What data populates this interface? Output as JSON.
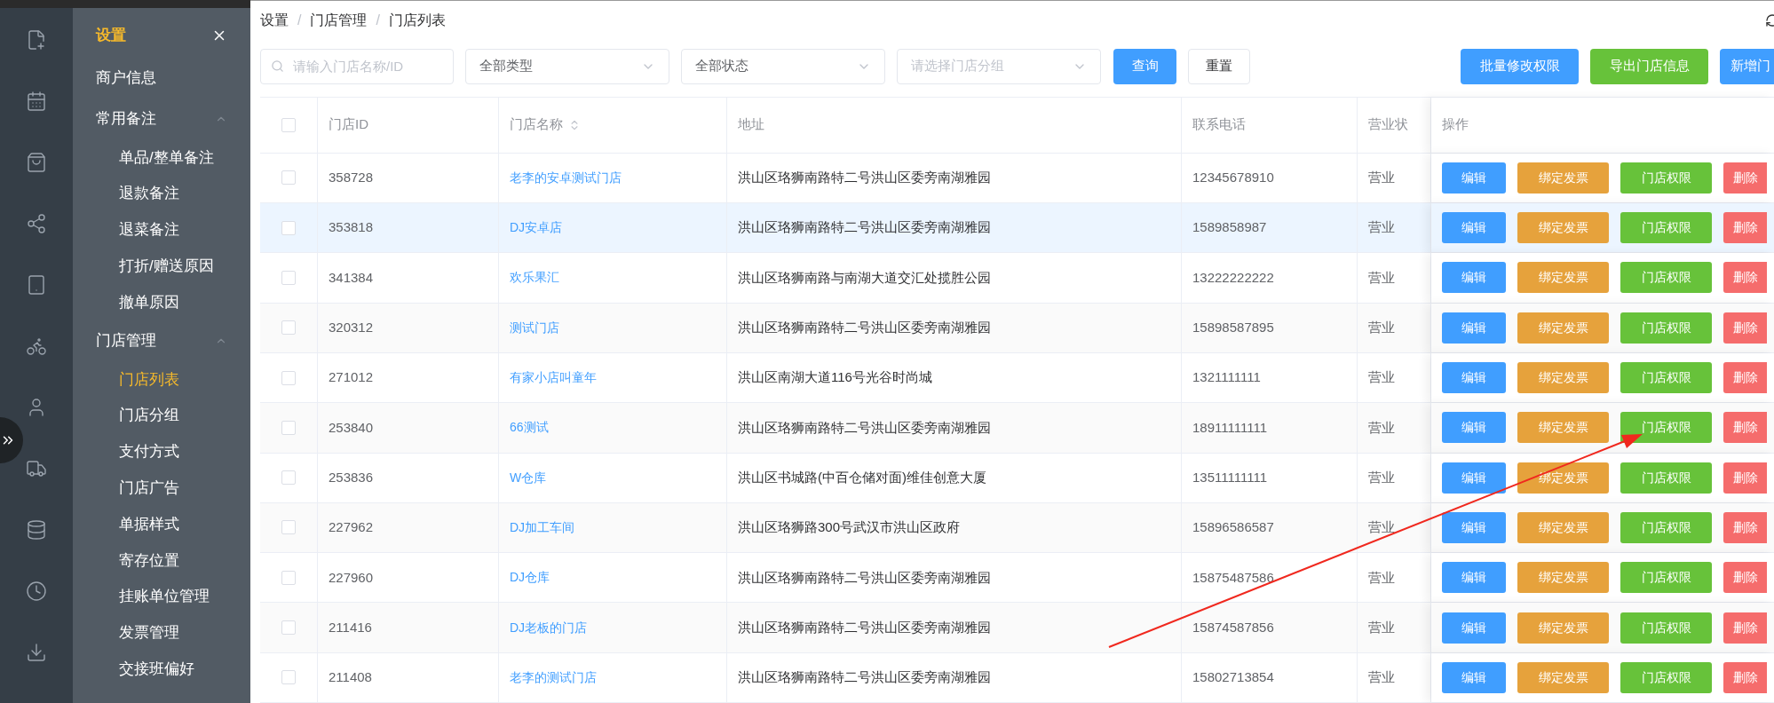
{
  "submenu": {
    "title": "设置",
    "items": [
      {
        "label": "商户信息",
        "selected": false
      },
      {
        "label": "常用备注",
        "expanded": true,
        "children": [
          {
            "label": "单品/整单备注",
            "selected": false
          },
          {
            "label": "退款备注",
            "selected": false
          },
          {
            "label": "退菜备注",
            "selected": false
          },
          {
            "label": "打折/赠送原因",
            "selected": false
          },
          {
            "label": "撤单原因",
            "selected": false
          }
        ]
      },
      {
        "label": "门店管理",
        "expanded": true,
        "children": [
          {
            "label": "门店列表",
            "selected": true
          },
          {
            "label": "门店分组",
            "selected": false
          },
          {
            "label": "支付方式",
            "selected": false
          },
          {
            "label": "门店广告",
            "selected": false
          },
          {
            "label": "单据样式",
            "selected": false
          },
          {
            "label": "寄存位置",
            "selected": false
          },
          {
            "label": "挂账单位管理",
            "selected": false
          },
          {
            "label": "发票管理",
            "selected": false
          },
          {
            "label": "交接班偏好",
            "selected": false
          }
        ]
      }
    ]
  },
  "breadcrumb": {
    "separator": "/",
    "items": [
      "设置",
      "门店管理",
      "门店列表"
    ]
  },
  "filters": {
    "search": {
      "placeholder": "请输入门店名称/ID"
    },
    "selects": [
      {
        "value": "全部类型"
      },
      {
        "value": "全部状态"
      },
      {
        "placeholder": "请选择门店分组"
      }
    ],
    "query_button": "查询",
    "reset_button": "重置"
  },
  "toolbar_buttons": [
    {
      "label": "批量修改权限",
      "kind": "primary"
    },
    {
      "label": "导出门店信息",
      "kind": "success"
    },
    {
      "label": "新增门",
      "kind": "primary"
    }
  ],
  "table": {
    "header_checked": false,
    "columns": [
      "门店ID",
      "门店名称",
      "地址",
      "联系电话",
      "营业状",
      "操作"
    ],
    "rows": [
      {
        "checked": false,
        "hovered": false,
        "id": "358728",
        "name": "老李的安卓测试门店",
        "address": "洪山区珞狮南路特二号洪山区委旁南湖雅园",
        "phone": "12345678910",
        "status": "营业",
        "actions": [
          {
            "label": "编辑",
            "kind": "edit"
          },
          {
            "label": "绑定发票",
            "kind": "invoice"
          },
          {
            "label": "门店权限",
            "kind": "permission"
          },
          {
            "label": "删除",
            "kind": "delete"
          }
        ]
      },
      {
        "checked": false,
        "hovered": true,
        "id": "353818",
        "name": "DJ安卓店",
        "address": "洪山区珞狮南路特二号洪山区委旁南湖雅园",
        "phone": "1589858987",
        "status": "营业",
        "actions": [
          {
            "label": "编辑",
            "kind": "edit"
          },
          {
            "label": "绑定发票",
            "kind": "invoice"
          },
          {
            "label": "门店权限",
            "kind": "permission"
          },
          {
            "label": "删除",
            "kind": "delete"
          }
        ]
      },
      {
        "checked": false,
        "hovered": false,
        "id": "341384",
        "name": "欢乐果汇",
        "address": "洪山区珞狮南路与南湖大道交汇处揽胜公园",
        "phone": "13222222222",
        "status": "营业",
        "actions": [
          {
            "label": "编辑",
            "kind": "edit"
          },
          {
            "label": "绑定发票",
            "kind": "invoice"
          },
          {
            "label": "门店权限",
            "kind": "permission"
          },
          {
            "label": "删除",
            "kind": "delete"
          }
        ]
      },
      {
        "checked": false,
        "hovered": false,
        "id": "320312",
        "name": "测试门店",
        "address": "洪山区珞狮南路特二号洪山区委旁南湖雅园",
        "phone": "15898587895",
        "status": "营业",
        "actions": [
          {
            "label": "编辑",
            "kind": "edit"
          },
          {
            "label": "绑定发票",
            "kind": "invoice"
          },
          {
            "label": "门店权限",
            "kind": "permission"
          },
          {
            "label": "删除",
            "kind": "delete"
          }
        ]
      },
      {
        "checked": false,
        "hovered": false,
        "id": "271012",
        "name": "有家小店叫童年",
        "address": "洪山区南湖大道116号光谷时尚城",
        "phone": "1321111111",
        "status": "营业",
        "actions": [
          {
            "label": "编辑",
            "kind": "edit"
          },
          {
            "label": "绑定发票",
            "kind": "invoice"
          },
          {
            "label": "门店权限",
            "kind": "permission"
          },
          {
            "label": "删除",
            "kind": "delete"
          }
        ]
      },
      {
        "checked": false,
        "hovered": false,
        "id": "253840",
        "name": "66测试",
        "address": "洪山区珞狮南路特二号洪山区委旁南湖雅园",
        "phone": "18911111111",
        "status": "营业",
        "actions": [
          {
            "label": "编辑",
            "kind": "edit"
          },
          {
            "label": "绑定发票",
            "kind": "invoice"
          },
          {
            "label": "门店权限",
            "kind": "permission"
          },
          {
            "label": "删除",
            "kind": "delete"
          }
        ]
      },
      {
        "checked": false,
        "hovered": false,
        "id": "253836",
        "name": "W仓库",
        "address": "洪山区书城路(中百仓储对面)维佳创意大厦",
        "phone": "13511111111",
        "status": "营业",
        "actions": [
          {
            "label": "编辑",
            "kind": "edit"
          },
          {
            "label": "绑定发票",
            "kind": "invoice"
          },
          {
            "label": "门店权限",
            "kind": "permission"
          },
          {
            "label": "删除",
            "kind": "delete"
          }
        ]
      },
      {
        "checked": false,
        "hovered": false,
        "id": "227962",
        "name": "DJ加工车间",
        "address": "洪山区珞狮路300号武汉市洪山区政府",
        "phone": "15896586587",
        "status": "营业",
        "actions": [
          {
            "label": "编辑",
            "kind": "edit"
          },
          {
            "label": "绑定发票",
            "kind": "invoice"
          },
          {
            "label": "门店权限",
            "kind": "permission"
          },
          {
            "label": "删除",
            "kind": "delete"
          }
        ]
      },
      {
        "checked": false,
        "hovered": false,
        "id": "227960",
        "name": "DJ仓库",
        "address": "洪山区珞狮南路特二号洪山区委旁南湖雅园",
        "phone": "15875487586",
        "status": "营业",
        "actions": [
          {
            "label": "编辑",
            "kind": "edit"
          },
          {
            "label": "绑定发票",
            "kind": "invoice"
          },
          {
            "label": "门店权限",
            "kind": "permission"
          },
          {
            "label": "删除",
            "kind": "delete"
          }
        ]
      },
      {
        "checked": false,
        "hovered": false,
        "id": "211416",
        "name": "DJ老板的门店",
        "address": "洪山区珞狮南路特二号洪山区委旁南湖雅园",
        "phone": "15874587856",
        "status": "营业",
        "actions": [
          {
            "label": "编辑",
            "kind": "edit"
          },
          {
            "label": "绑定发票",
            "kind": "invoice"
          },
          {
            "label": "门店权限",
            "kind": "permission"
          },
          {
            "label": "删除",
            "kind": "delete"
          }
        ]
      },
      {
        "checked": false,
        "hovered": false,
        "id": "211408",
        "name": "老李的测试门店",
        "address": "洪山区珞狮南路特二号洪山区委旁南湖雅园",
        "phone": "15802713854",
        "status": "营业",
        "actions": [
          {
            "label": "编辑",
            "kind": "edit"
          },
          {
            "label": "绑定发票",
            "kind": "invoice"
          },
          {
            "label": "门店权限",
            "kind": "permission"
          },
          {
            "label": "删除",
            "kind": "delete"
          }
        ]
      }
    ]
  }
}
